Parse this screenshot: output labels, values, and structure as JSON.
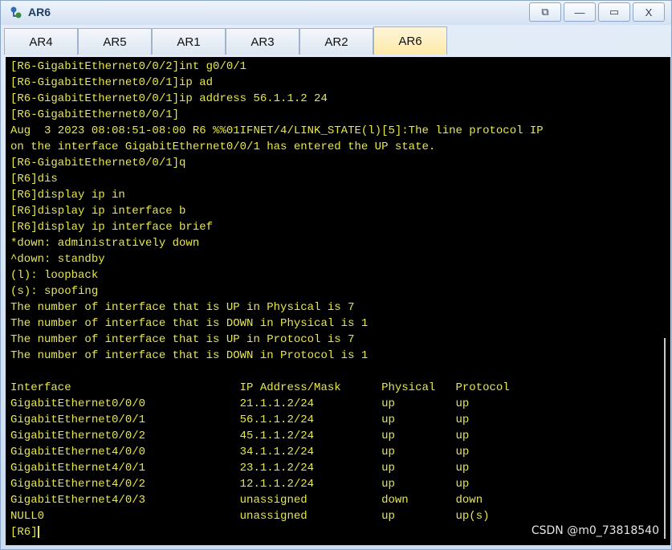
{
  "window": {
    "title": "AR6",
    "minimize_label": "—",
    "maximize_label": "▭",
    "close_label": "X",
    "restore_label": "⧉"
  },
  "tabs": [
    {
      "label": "AR4",
      "active": false
    },
    {
      "label": "AR5",
      "active": false
    },
    {
      "label": "AR1",
      "active": false
    },
    {
      "label": "AR3",
      "active": false
    },
    {
      "label": "AR2",
      "active": false
    },
    {
      "label": "AR6",
      "active": true
    }
  ],
  "terminal": {
    "lines": [
      "[R6-GigabitEthernet0/0/2]int g0/0/1",
      "[R6-GigabitEthernet0/0/1]ip ad",
      "[R6-GigabitEthernet0/0/1]ip address 56.1.1.2 24",
      "[R6-GigabitEthernet0/0/1]",
      "Aug  3 2023 08:08:51-08:00 R6 %%01IFNET/4/LINK_STATE(l)[5]:The line protocol IP",
      "on the interface GigabitEthernet0/0/1 has entered the UP state.",
      "[R6-GigabitEthernet0/0/1]q",
      "[R6]dis",
      "[R6]display ip in",
      "[R6]display ip interface b",
      "[R6]display ip interface brief",
      "*down: administratively down",
      "^down: standby",
      "(l): loopback",
      "(s): spoofing",
      "The number of interface that is UP in Physical is 7",
      "The number of interface that is DOWN in Physical is 1",
      "The number of interface that is UP in Protocol is 7",
      "The number of interface that is DOWN in Protocol is 1",
      "",
      "Interface                         IP Address/Mask      Physical   Protocol",
      "GigabitEthernet0/0/0              21.1.1.2/24          up         up",
      "GigabitEthernet0/0/1              56.1.1.2/24          up         up",
      "GigabitEthernet0/0/2              45.1.1.2/24          up         up",
      "GigabitEthernet4/0/0              34.1.1.2/24          up         up",
      "GigabitEthernet4/0/1              23.1.1.2/24          up         up",
      "GigabitEthernet4/0/2              12.1.1.2/24          up         up",
      "GigabitEthernet4/0/3              unassigned           down       down",
      "NULL0                             unassigned           up         up(s)"
    ],
    "prompt": "[R6]"
  },
  "watermark": "CSDN @m0_73818540",
  "colors": {
    "terminal_bg": "#000000",
    "terminal_text": "#e8e84a",
    "active_tab": "#fde9a6"
  }
}
